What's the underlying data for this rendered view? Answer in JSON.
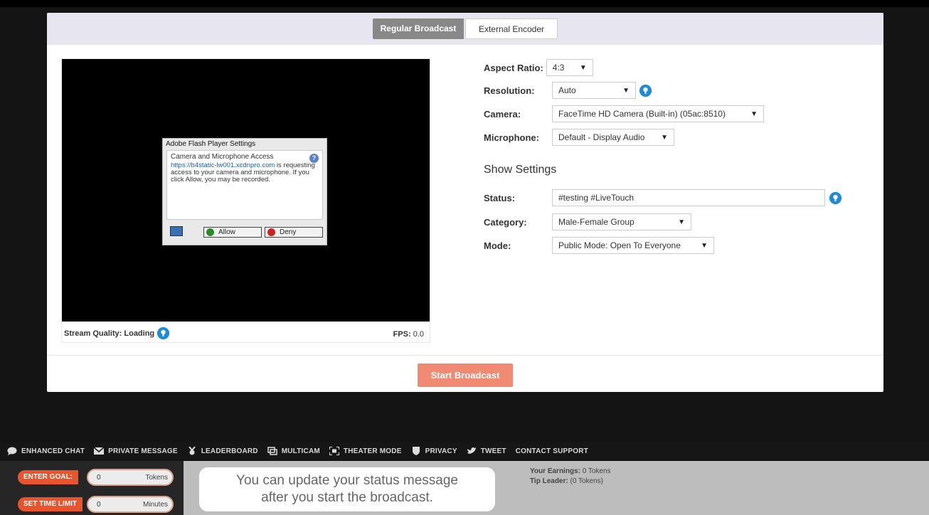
{
  "tabs": {
    "regular": "Regular Broadcast",
    "external": "External Encoder"
  },
  "preview": {
    "stream_quality_label": "Stream Quality:",
    "stream_quality_value": "Loading",
    "fps_label": "FPS:",
    "fps_value": "0.0"
  },
  "flash_dialog": {
    "title": "Adobe Flash Player Settings",
    "heading": "Camera and Microphone Access",
    "link": "https://b4static-lw001.xcdnpro.com",
    "message_after_link": "is requesting access to your camera and microphone. If you click Allow, you may be recorded.",
    "help_glyph": "?",
    "allow_label": "Allow",
    "deny_label": "Deny"
  },
  "settings": {
    "aspect_ratio_label": "Aspect Ratio:",
    "aspect_ratio_value": "4:3",
    "resolution_label": "Resolution:",
    "resolution_value": "Auto",
    "camera_label": "Camera:",
    "camera_value": "FaceTime HD Camera (Built-in) (05ac:8510)",
    "microphone_label": "Microphone:",
    "microphone_value": "Default - Display Audio"
  },
  "show_settings": {
    "title": "Show Settings",
    "status_label": "Status:",
    "status_value": "#testing #LiveTouch",
    "category_label": "Category:",
    "category_value": "Male-Female Group",
    "mode_label": "Mode:",
    "mode_value": "Public Mode: Open To Everyone"
  },
  "start_button": "Start Broadcast",
  "toolbar": {
    "enhanced_chat": "ENHANCED CHAT",
    "private_message": "PRIVATE MESSAGE",
    "leaderboard": "LEADERBOARD",
    "multicam": "MULTICAM",
    "theater_mode": "THEATER MODE",
    "privacy": "PRIVACY",
    "tweet": "TWEET",
    "contact_support": "CONTACT SUPPORT"
  },
  "goal": {
    "label": "ENTER GOAL:",
    "value": "0",
    "unit": "Tokens"
  },
  "time_limit": {
    "label": "SET TIME LIMIT",
    "value": "0",
    "unit": "Minutes"
  },
  "tip_message": {
    "line1": "You can update your status message",
    "line2": "after you start the broadcast."
  },
  "earnings": {
    "earnings_label": "Your Earnings:",
    "earnings_value": "0 Tokens",
    "tip_leader_label": "Tip Leader:",
    "tip_leader_value": "(0 Tokens)"
  },
  "colors": {
    "accent_orange": "#e8542c",
    "start_button": "#f08a73",
    "info_blue": "#1c8cd9"
  }
}
